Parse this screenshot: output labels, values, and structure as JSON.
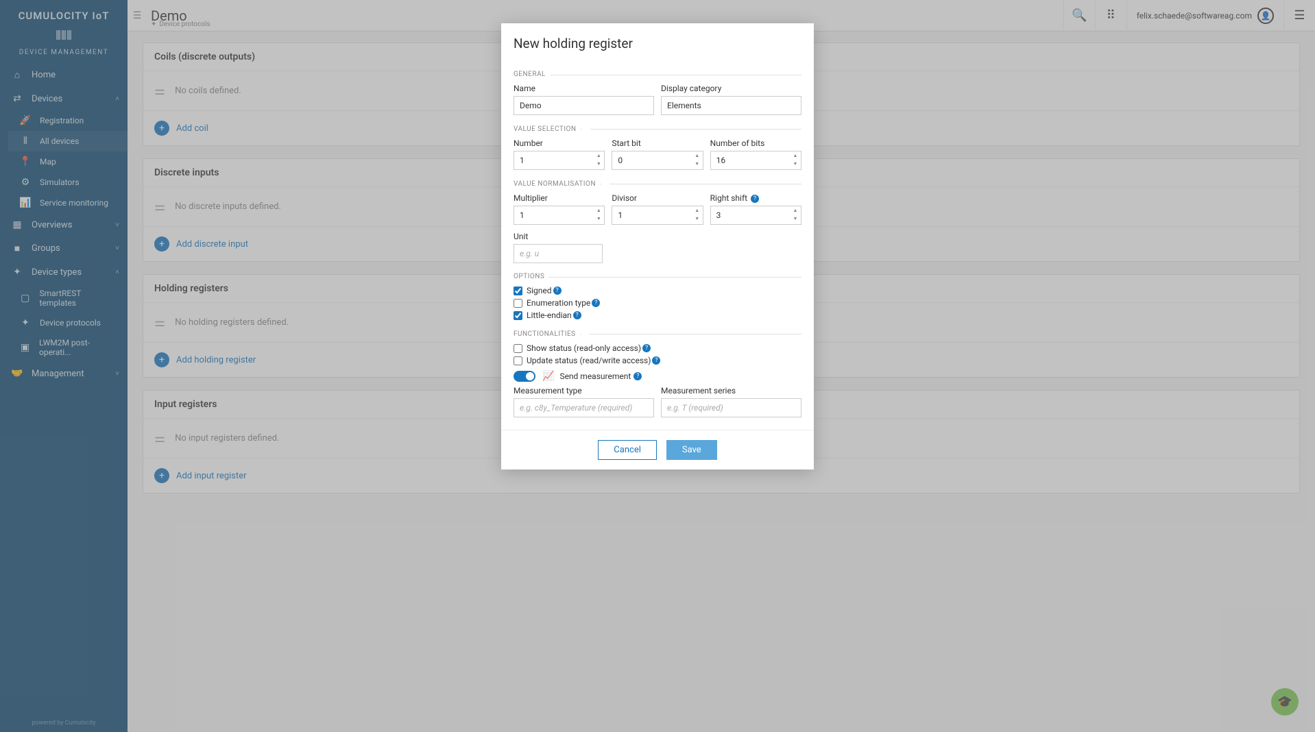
{
  "brand": "CUMULOCITY IoT",
  "subtitle": "DEVICE MANAGEMENT",
  "sidebar": {
    "footer": "powered by Cumulocity",
    "items": [
      {
        "icon": "⌂",
        "label": "Home"
      },
      {
        "icon": "⇄",
        "label": "Devices",
        "expanded": true,
        "chev": "˄",
        "children": [
          {
            "icon": "🚀",
            "label": "Registration"
          },
          {
            "icon": "⦀",
            "label": "All devices"
          },
          {
            "icon": "📍",
            "label": "Map"
          },
          {
            "icon": "⚙",
            "label": "Simulators"
          },
          {
            "icon": "📊",
            "label": "Service monitoring"
          }
        ]
      },
      {
        "icon": "▦",
        "label": "Overviews",
        "chev": "˅"
      },
      {
        "icon": "■",
        "label": "Groups",
        "chev": "˅"
      },
      {
        "icon": "✦",
        "label": "Device types",
        "expanded": true,
        "chev": "˄",
        "children": [
          {
            "icon": "▢",
            "label": "SmartREST templates"
          },
          {
            "icon": "✦",
            "label": "Device protocols"
          },
          {
            "icon": "▣",
            "label": "LWM2M post-operati..."
          }
        ]
      },
      {
        "icon": "🤝",
        "label": "Management",
        "chev": "˅"
      }
    ]
  },
  "topbar": {
    "title": "Demo",
    "breadcrumb": "Device protocols",
    "user": "felix.schaede@softwareag.com"
  },
  "cards": [
    {
      "title": "Coils (discrete outputs)",
      "empty": "No coils defined.",
      "action": "Add coil"
    },
    {
      "title": "Discrete inputs",
      "empty": "No discrete inputs defined.",
      "action": "Add discrete input"
    },
    {
      "title": "Holding registers",
      "empty": "No holding registers defined.",
      "action": "Add holding register"
    },
    {
      "title": "Input registers",
      "empty": "No input registers defined.",
      "action": "Add input register"
    }
  ],
  "modal": {
    "title": "New holding register",
    "sections": {
      "general": "GENERAL",
      "value_selection": "VALUE SELECTION",
      "value_normalisation": "VALUE NORMALISATION",
      "options": "OPTIONS",
      "functionalities": "FUNCTIONALITIES"
    },
    "fields": {
      "name_label": "Name",
      "name_value": "Demo",
      "category_label": "Display category",
      "category_value": "Elements",
      "number_label": "Number",
      "number_value": "1",
      "startbit_label": "Start bit",
      "startbit_value": "0",
      "numbits_label": "Number of bits",
      "numbits_value": "16",
      "multiplier_label": "Multiplier",
      "multiplier_value": "1",
      "divisor_label": "Divisor",
      "divisor_value": "1",
      "rightshift_label": "Right shift",
      "rightshift_value": "3",
      "unit_label": "Unit",
      "unit_placeholder": "e.g. u",
      "signed_label": "Signed",
      "enum_label": "Enumeration type",
      "littleendian_label": "Little-endian",
      "showstatus_label": "Show status (read-only access)",
      "updatestatus_label": "Update status (read/write access)",
      "sendmeasurement_label": "Send measurement",
      "mtype_label": "Measurement type",
      "mtype_placeholder": "e.g. c8y_Temperature (required)",
      "mseries_label": "Measurement series",
      "mseries_placeholder": "e.g. T (required)"
    },
    "buttons": {
      "cancel": "Cancel",
      "save": "Save"
    }
  }
}
